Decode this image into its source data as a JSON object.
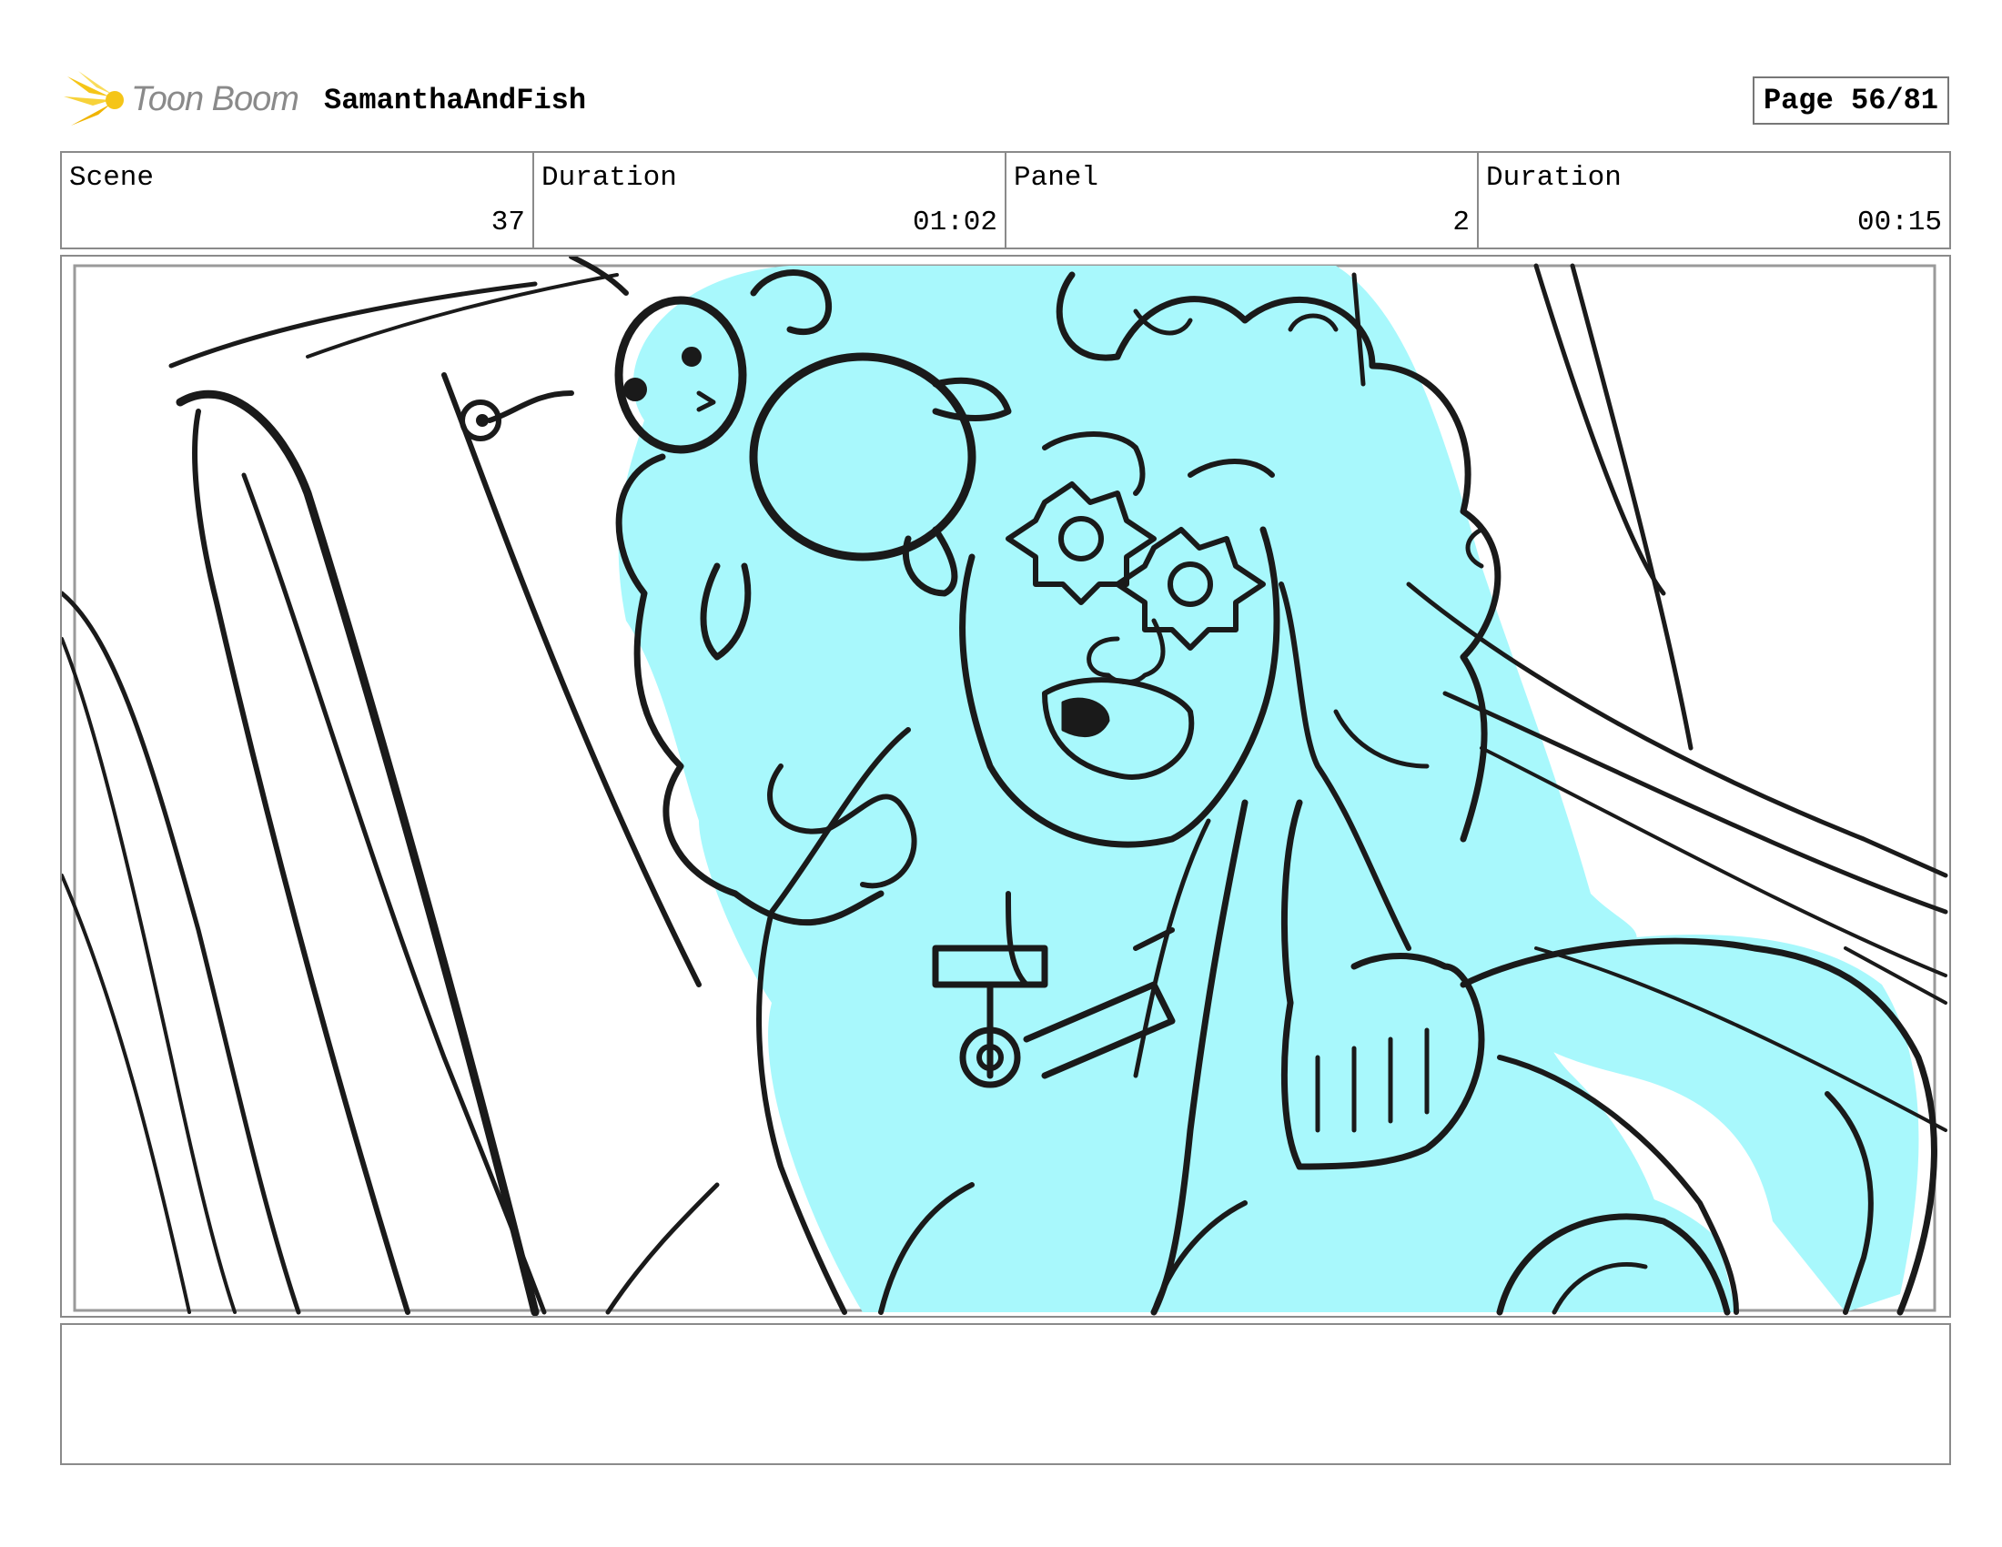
{
  "header": {
    "logo_text": "Toon Boom",
    "project_title": "SamanthaAndFish",
    "page_label": "Page 56/81"
  },
  "info": [
    {
      "label": "Scene",
      "value": "37"
    },
    {
      "label": "Duration",
      "value": "01:02"
    },
    {
      "label": "Panel",
      "value": "2"
    },
    {
      "label": "Duration",
      "value": "00:15"
    }
  ],
  "panel": {
    "fill_color": "#a8f8fc",
    "line_color": "#1a1a1a"
  },
  "notes": {
    "text": ""
  },
  "colors": {
    "logo_star": "#f5c518",
    "border": "#8a8a8a"
  }
}
